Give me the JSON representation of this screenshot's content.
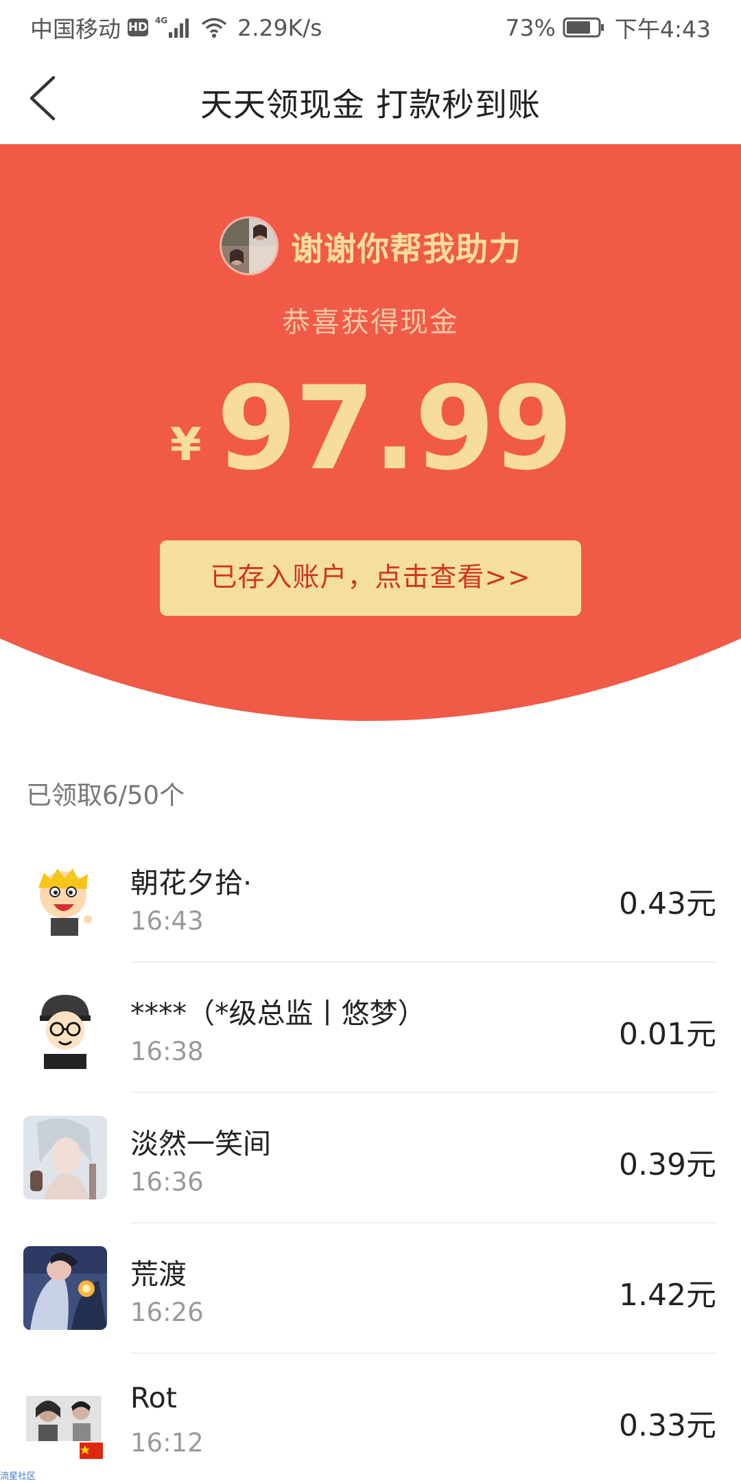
{
  "status_bar": {
    "carrier": "中国移动",
    "hd": "HD",
    "network": "4G",
    "speed": "2.29K/s",
    "battery": "73%",
    "time": "下午4:43"
  },
  "header": {
    "title": "天天领现金 打款秒到账"
  },
  "hero": {
    "helper_text": "谢谢你帮我助力",
    "congrats": "恭喜获得现金",
    "currency": "¥",
    "amount": "97.99",
    "deposit_button": "已存入账户，点击查看>>"
  },
  "claimed_label": "已领取6/50个",
  "records": [
    {
      "name": "朝花夕拾·",
      "time": "16:43",
      "amount": "0.43元"
    },
    {
      "name": "****（*级总监丨悠梦）",
      "time": "16:38",
      "amount": "0.01元"
    },
    {
      "name": "淡然一笑间",
      "time": "16:36",
      "amount": "0.39元"
    },
    {
      "name": "荒渡",
      "time": "16:26",
      "amount": "1.42元"
    },
    {
      "name": "Rot",
      "time": "16:12",
      "amount": "0.33元"
    }
  ],
  "watermark": "流星社区",
  "colors": {
    "hero_red": "#f05a47",
    "gold_text": "#f7dca0",
    "button_bg": "#f4dfa1",
    "button_text": "#d2341f"
  }
}
